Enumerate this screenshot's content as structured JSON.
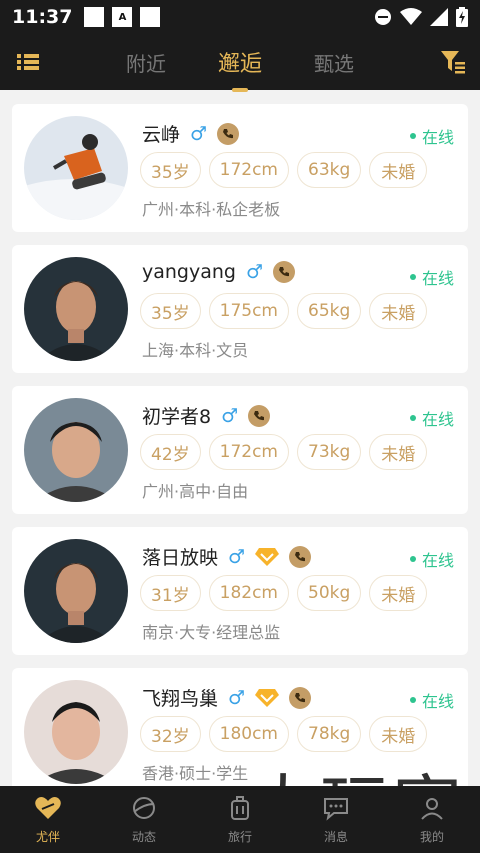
{
  "status": {
    "time": "11:37",
    "a_icon": "A"
  },
  "tabs": [
    {
      "label": "附近"
    },
    {
      "label": "邂逅"
    },
    {
      "label": "甄选"
    }
  ],
  "colors": {
    "accent": "#e5b757",
    "online": "#2ec48f",
    "male": "#3aa2e6",
    "tag_text": "#c9a063",
    "phone_bg": "#c49d66"
  },
  "users": [
    {
      "name": "云峥",
      "gender_symbol": "♂",
      "vip": false,
      "online": "在线",
      "tags": [
        "35岁",
        "172cm",
        "63kg",
        "未婚"
      ],
      "desc": "广州·本科·私企老板"
    },
    {
      "name": "yangyang",
      "gender_symbol": "♂",
      "vip": false,
      "online": "在线",
      "tags": [
        "35岁",
        "175cm",
        "65kg",
        "未婚"
      ],
      "desc": "上海·本科·文员"
    },
    {
      "name": "初学者8",
      "gender_symbol": "♂",
      "vip": false,
      "online": "在线",
      "tags": [
        "42岁",
        "172cm",
        "73kg",
        "未婚"
      ],
      "desc": "广州·高中·自由"
    },
    {
      "name": "落日放映",
      "gender_symbol": "♂",
      "vip": true,
      "online": "在线",
      "tags": [
        "31岁",
        "182cm",
        "50kg",
        "未婚"
      ],
      "desc": "南京·大专·经理总监"
    },
    {
      "name": "飞翔鸟巢",
      "gender_symbol": "♂",
      "vip": true,
      "online": "在线",
      "tags": [
        "32岁",
        "180cm",
        "78kg",
        "未婚"
      ],
      "desc": "香港·硕士·学生"
    }
  ],
  "watermark": "大玩家",
  "bottom_nav": [
    {
      "label": "尤伴",
      "icon": "heart-icon"
    },
    {
      "label": "动态",
      "icon": "planet-icon"
    },
    {
      "label": "旅行",
      "icon": "luggage-icon"
    },
    {
      "label": "消息",
      "icon": "chat-icon"
    },
    {
      "label": "我的",
      "icon": "profile-icon"
    }
  ]
}
